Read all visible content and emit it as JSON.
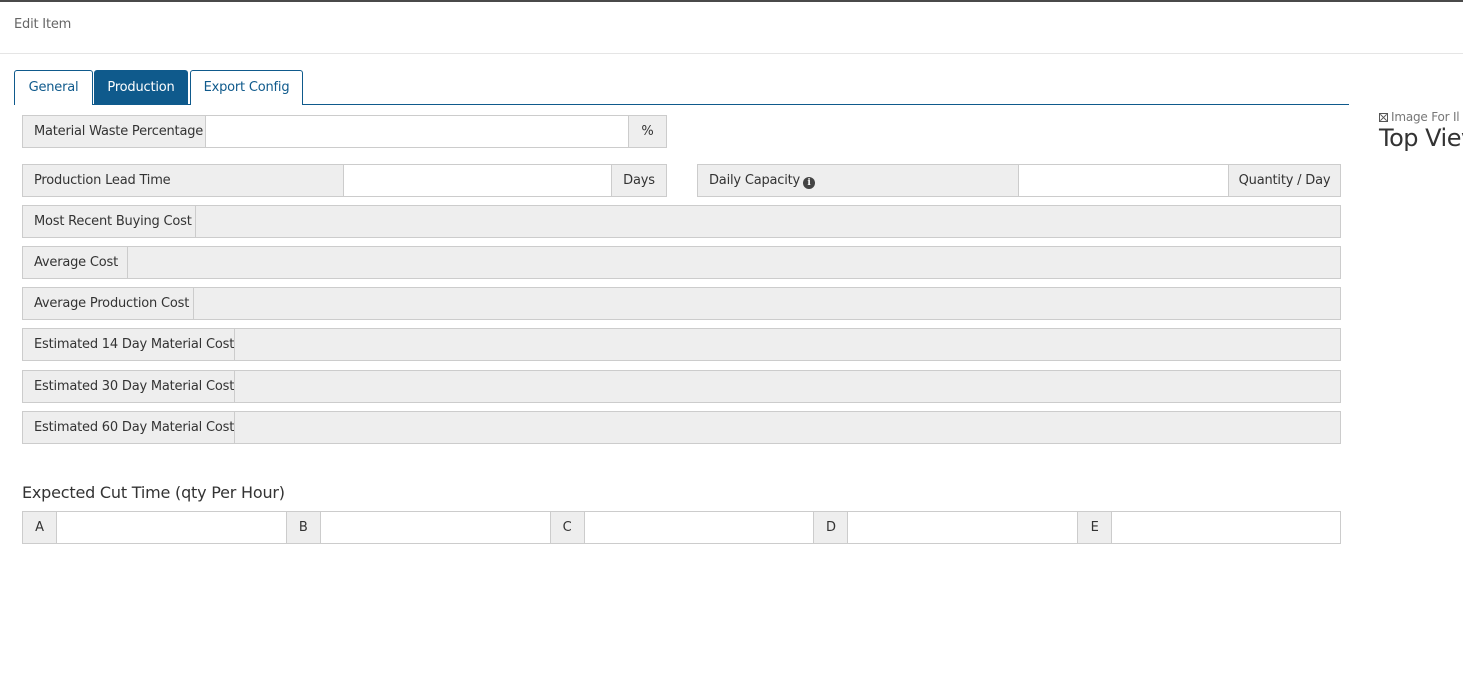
{
  "modal": {
    "title": "Edit Item"
  },
  "tabs": [
    {
      "label": "General",
      "active": false
    },
    {
      "label": "Production",
      "active": true
    },
    {
      "label": "Export Config",
      "active": false
    }
  ],
  "form": {
    "material_waste": {
      "label": "Material Waste Percentage",
      "value": "",
      "unit": "%"
    },
    "lead_time": {
      "label": "Production Lead Time",
      "value": "",
      "unit": "Days"
    },
    "daily_capacity": {
      "label": "Daily Capacity",
      "value": "",
      "unit": "Quantity / Day",
      "icon": "info-icon"
    },
    "recent_buying_cost": {
      "label": "Most Recent Buying Cost",
      "value": ""
    },
    "average_cost": {
      "label": "Average Cost",
      "value": ""
    },
    "average_production_cost": {
      "label": "Average Production Cost",
      "value": ""
    },
    "est_14": {
      "label": "Estimated 14 Day Material Cost",
      "value": ""
    },
    "est_30": {
      "label": "Estimated 30 Day Material Cost",
      "value": ""
    },
    "est_60": {
      "label": "Estimated 60 Day Material Cost",
      "value": ""
    }
  },
  "cut_time": {
    "title": "Expected Cut Time (qty Per Hour)",
    "fields": [
      {
        "label": "A",
        "value": ""
      },
      {
        "label": "B",
        "value": ""
      },
      {
        "label": "C",
        "value": ""
      },
      {
        "label": "D",
        "value": ""
      },
      {
        "label": "E",
        "value": ""
      }
    ]
  },
  "side_panel": {
    "caption": "Image For Il",
    "title": "Top Viev",
    "icon": "expand-icon"
  }
}
